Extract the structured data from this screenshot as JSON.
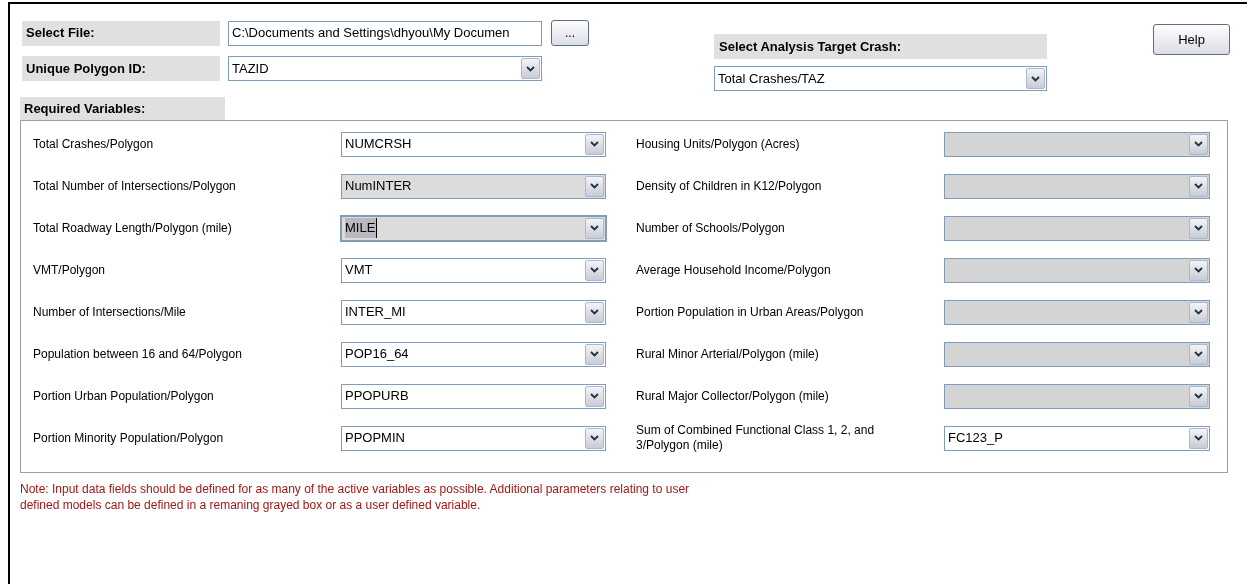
{
  "select_file": {
    "label": "Select File:",
    "value": "C:\\Documents and Settings\\dhyou\\My Documen",
    "browse_button": "..."
  },
  "unique_polygon_id": {
    "label": "Unique Polygon ID:",
    "value": "TAZID"
  },
  "analysis_target": {
    "label": "Select Analysis Target Crash:",
    "value": "Total Crashes/TAZ"
  },
  "help_button": "Help",
  "required_variables": {
    "label": "Required Variables:",
    "left": [
      {
        "label": "Total Crashes/Polygon",
        "value": "NUMCRSH",
        "grayed": false,
        "focused": false,
        "disabled": false
      },
      {
        "label": "Total Number of Intersections/Polygon",
        "value": "NumINTER",
        "grayed": true,
        "focused": false,
        "disabled": false
      },
      {
        "label": "Total Roadway Length/Polygon (mile)",
        "value": "MILE",
        "grayed": true,
        "focused": true,
        "disabled": false
      },
      {
        "label": "VMT/Polygon",
        "value": "VMT",
        "grayed": false,
        "focused": false,
        "disabled": false
      },
      {
        "label": "Number of Intersections/Mile",
        "value": "INTER_MI",
        "grayed": false,
        "focused": false,
        "disabled": false
      },
      {
        "label": "Population between 16 and 64/Polygon",
        "value": "POP16_64",
        "grayed": false,
        "focused": false,
        "disabled": false
      },
      {
        "label": "Portion Urban Population/Polygon",
        "value": "PPOPURB",
        "grayed": false,
        "focused": false,
        "disabled": false
      },
      {
        "label": "Portion Minority Population/Polygon",
        "value": "PPOPMIN",
        "grayed": false,
        "focused": false,
        "disabled": false
      }
    ],
    "right": [
      {
        "label": "Housing Units/Polygon (Acres)",
        "disabled": true
      },
      {
        "label": "Density of Children in K12/Polygon",
        "disabled": true
      },
      {
        "label": "Number of Schools/Polygon",
        "disabled": true
      },
      {
        "label": "Average Household Income/Polygon",
        "disabled": true
      },
      {
        "label": "Portion Population in Urban Areas/Polygon",
        "disabled": true
      },
      {
        "label": "Rural Minor Arterial/Polygon (mile)",
        "disabled": true
      },
      {
        "label": "Rural Major Collector/Polygon (mile)",
        "disabled": true
      },
      {
        "label": "Sum of Combined Functional Class 1, 2, and 3/Polygon (mile)",
        "value": "FC123_P",
        "grayed": false,
        "focused": false,
        "disabled": false
      }
    ]
  },
  "note": "Note: Input data fields should be defined for as many of the active variables as possible. Additional parameters relating to user defined models can be defined in a remaning grayed box or as a user defined variable."
}
